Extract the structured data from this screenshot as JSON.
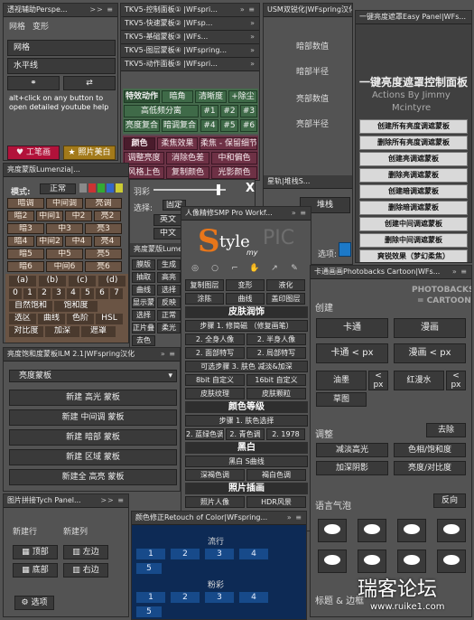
{
  "p1": {
    "title": "透视辅助Perspe...",
    "ctl": ">> ≡",
    "items": [
      "网格",
      "变形",
      "网格",
      "水平线"
    ],
    "note": "alt+click on any button to open detailed youtube help",
    "btn_a": "工笔画",
    "btn_b": "照片美白"
  },
  "p2": {
    "tabs": [
      "TKV5-控制面板① |WFspri...",
      "TKV5-快速蒙板② |WFsp...",
      "TKV5-基础蒙板③ |WFs...",
      "TKV5-图层蒙板④ |WFspring...",
      "TKV5-动作面板⑤ |WFspri..."
    ],
    "r1": [
      "特效动作",
      "暗角",
      "清晰度",
      "+除尘"
    ],
    "r2": [
      "高低频分离",
      "#1",
      "#2",
      "#3"
    ],
    "r3": [
      "亮度复合",
      "暗调复合",
      "#4",
      "#5",
      "#6"
    ],
    "c1": [
      "颜色",
      "柔焦效果",
      "柔焦 - 保留细节"
    ],
    "c2": [
      "调整亮度",
      "消除色差",
      "中和偏色"
    ],
    "c3": [
      "风格上色",
      "复制颜色",
      "光影颜色"
    ]
  },
  "p3": {
    "title": "USM双锐化|WFspring汉化",
    "fields": [
      "暗部数值",
      "暗部半径",
      "亮部数值",
      "亮部半径"
    ],
    "row": "星轨|堆栈S...",
    "btn": "堆栈",
    "sel": "选项:"
  },
  "p4": {
    "title": "一键亮度遮罩Easy Panel|WFs...",
    "heading": "一键亮度遮罩控制面板",
    "sub1": "Actions By Jimmy",
    "sub2": "Mcintyre",
    "buttons": [
      "创建所有亮度调遮蒙板",
      "删除所有亮度调遮蒙板",
      "创建亮调遮蒙板",
      "删除亮调遮蒙板",
      "创建暗调遮蒙板",
      "删除暗调遮蒙板",
      "创建中间调遮蒙板",
      "删除中间调遮蒙板",
      "爽锐效果（梦幻柔焦）"
    ]
  },
  "p5": {
    "title": "亮度蒙版Lumenzia|...",
    "mode_label": "模式:",
    "mode": "正常",
    "rows": [
      [
        "暗调",
        "中间调",
        "亮调"
      ],
      [
        "暗2",
        "中间1",
        "中2",
        "亮2"
      ],
      [
        "暗3",
        "中3",
        "亮3"
      ],
      [
        "暗4",
        "中间2",
        "中4",
        "亮4"
      ],
      [
        "暗5",
        "中5",
        "亮5"
      ],
      [
        "暗6",
        "中间6",
        "亮6"
      ]
    ],
    "letters": [
      "(a)",
      "(b)",
      "(c)",
      "(d)"
    ],
    "nums": [
      "0",
      "1",
      "2",
      "3",
      "4",
      "5",
      "6",
      "7"
    ],
    "f1": [
      "自然饱和",
      "饱和度"
    ],
    "f2": [
      "选区",
      "曲线",
      "色阶",
      "HSL"
    ],
    "f3": [
      "对比度",
      "加深",
      "遮罩"
    ]
  },
  "p6": {
    "label": "羽彩",
    "x": "X",
    "sel_label": "选择:",
    "sel": "固定",
    "btns": [
      "英文",
      "中文"
    ],
    "sub": "亮度蒙版Lumen...",
    "grid": [
      "膜版",
      "生成",
      "抽取",
      "高亮",
      "曲线",
      "选择",
      "显示蒙板",
      "反映",
      "选择",
      "正常",
      "正片叠底",
      "柔光",
      "去色"
    ]
  },
  "p7": {
    "title": "人像精修SMP Pro Workf...",
    "logo_a": "S",
    "logo_b": "tyle",
    "logo_c": "my",
    "logo_d": "PIC",
    "tools": [
      "◎",
      "○",
      "⌐",
      "✋",
      "↗",
      "✎"
    ],
    "r1": [
      "复制图层",
      "变形",
      "液化"
    ],
    "r2": [
      "涂陈",
      "曲线",
      "盖印图层"
    ],
    "sec1": "皮肤润饰",
    "s1": "步骤 1. 修简磁 （修复画笔）",
    "r3": [
      "2. 全身人像",
      "2. 半身人像"
    ],
    "r4": [
      "2. 面部特写",
      "2. 局部特写"
    ],
    "s2": "可选步骤 3. 肤色 减淡&加深",
    "r5": [
      "8bit 自定义",
      "16bit 自定义"
    ],
    "r6": [
      "皮肤纹理",
      "皮肤颗粒"
    ],
    "sec2": "颜色等级",
    "s3": "步骤 1. 肤色选择",
    "r7": [
      "2. 蓝绿色调",
      "2. 青色调",
      "2. 1978"
    ],
    "sec3": "黑白",
    "s4": "黑白 S曲线",
    "r8": [
      "深褐色调",
      "褐白色调"
    ],
    "sec4": "照片插画",
    "r9": [
      "照片人像",
      "HDR风景"
    ]
  },
  "p8": {
    "title": "卡通画画Photobacks Cartoon|WFs...",
    "logo1": "PHOTOBACKS",
    "logo2": "= CARTOON =",
    "create": "创建",
    "b1": [
      "卡通",
      "漫画"
    ],
    "b2": [
      "卡通 < px",
      "漫画 < px"
    ],
    "b3": [
      "油墨",
      "<",
      "红漫水",
      "<"
    ],
    "px": "px",
    "b4": "草图",
    "adjust": "调整",
    "remove": "去除",
    "a1": [
      "减淡高光",
      "色相/饱和度"
    ],
    "a2": [
      "加深阴影",
      "亮度/对比度"
    ],
    "speech": "语言气泡",
    "reverse": "反向",
    "title_border": "标题 & 边框"
  },
  "p9": {
    "title": "亮度饱和度蒙板ILM 2.1|WFspring汉化",
    "combo": "亮度蒙板",
    "buttons": [
      "新建 高光 蒙板",
      "新建 中间调 蒙板",
      "新建 暗部 蒙板",
      "新建 区域 蒙板",
      "新建全 高亮 蒙板"
    ]
  },
  "p10": {
    "title": "图片拼接Tych Panel...",
    "ctl": ">> ≡",
    "col1": "新建行",
    "col2": "新建列",
    "btns": [
      "顶部",
      "左边",
      "底部",
      "右边"
    ],
    "opt": "选项"
  },
  "p11": {
    "title": "颜色修正Retouch of Color|WFspring...",
    "s1": "流行",
    "row1": [
      "1",
      "2",
      "3",
      "4"
    ],
    "one5": "5",
    "s2": "粉彩",
    "row2": [
      "1",
      "2",
      "3",
      "4"
    ],
    "two5": "5"
  },
  "watermark": {
    "text": "瑞客论坛",
    "url": "www.ruike1.com"
  }
}
